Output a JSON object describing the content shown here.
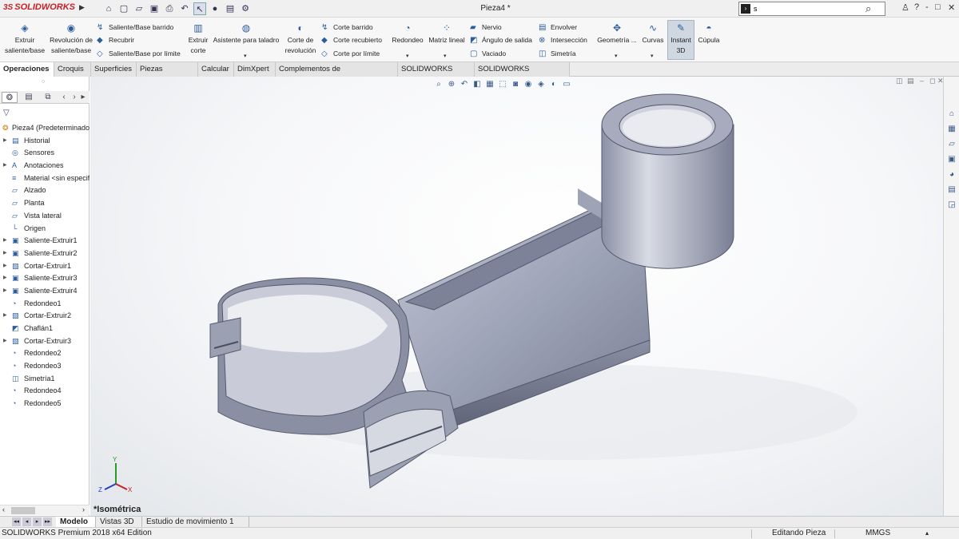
{
  "titlebar": {
    "logo_brand": "SOLIDWORKS",
    "logo_ds": "3S",
    "document_title": "Pieza4 *",
    "search_value": "s",
    "controls": [
      "?",
      "-",
      "—",
      "□",
      "✕"
    ]
  },
  "ribbon": {
    "extrude_boss": "Extruir saliente/base",
    "revolve_boss": "Revolución de saliente/base",
    "swept_boss": "Saliente/Base barrido",
    "loft_boss": "Recubrir",
    "boundary_boss": "Saliente/Base por límite",
    "extrude_cut": "Extruir corte",
    "hole_wizard": "Asistente para taladro",
    "revolve_cut": "Corte de revolución",
    "swept_cut": "Corte barrido",
    "loft_cut": "Corte recubierto",
    "boundary_cut": "Corte por límite",
    "fillet": "Redondeo",
    "linear_pattern": "Matriz lineal",
    "rib": "Nervio",
    "draft": "Ángulo de salida",
    "shell": "Vaciado",
    "wrap": "Envolver",
    "intersect": "Intersección",
    "mirror": "Simetría",
    "ref_geometry": "Geometría ...",
    "curves": "Curvas",
    "instant3d_line1": "Instant",
    "instant3d_line2": "3D",
    "dome": "Cúpula"
  },
  "command_tabs": [
    "Operaciones",
    "Croquis",
    "Superficies",
    "Piezas soldadas",
    "Calcular",
    "DimXpert",
    "Complementos de SOLIDWORKS",
    "SOLIDWORKS MBD",
    "SOLIDWORKS Inspection"
  ],
  "feature_tree": {
    "root": "Pieza4  (Predeterminado",
    "items": [
      {
        "label": "Historial",
        "icon": "history-icon",
        "glyph": "▤",
        "expand": true
      },
      {
        "label": "Sensores",
        "icon": "sensor-icon",
        "glyph": "◎",
        "expand": false
      },
      {
        "label": "Anotaciones",
        "icon": "annotation-icon",
        "glyph": "A",
        "expand": true
      },
      {
        "label": "Material <sin especificar>",
        "icon": "material-icon",
        "glyph": "≡",
        "expand": false
      },
      {
        "label": "Alzado",
        "icon": "plane-icon",
        "glyph": "▱",
        "expand": false
      },
      {
        "label": "Planta",
        "icon": "plane-icon",
        "glyph": "▱",
        "expand": false
      },
      {
        "label": "Vista lateral",
        "icon": "plane-icon",
        "glyph": "▱",
        "expand": false
      },
      {
        "label": "Origen",
        "icon": "origin-icon",
        "glyph": "└",
        "expand": false
      },
      {
        "label": "Saliente-Extruir1",
        "icon": "extrude-icon",
        "glyph": "▣",
        "expand": true
      },
      {
        "label": "Saliente-Extruir2",
        "icon": "extrude-icon",
        "glyph": "▣",
        "expand": true
      },
      {
        "label": "Cortar-Extruir1",
        "icon": "cut-icon",
        "glyph": "▧",
        "expand": true
      },
      {
        "label": "Saliente-Extruir3",
        "icon": "extrude-icon",
        "glyph": "▣",
        "expand": true
      },
      {
        "label": "Saliente-Extruir4",
        "icon": "extrude-icon",
        "glyph": "▣",
        "expand": true
      },
      {
        "label": "Redondeo1",
        "icon": "fillet-icon",
        "glyph": "◔",
        "expand": false
      },
      {
        "label": "Cortar-Extruir2",
        "icon": "cut-icon",
        "glyph": "▧",
        "expand": true
      },
      {
        "label": "Chaflán1",
        "icon": "chamfer-icon",
        "glyph": "◩",
        "expand": false
      },
      {
        "label": "Cortar-Extruir3",
        "icon": "cut-icon",
        "glyph": "▧",
        "expand": true
      },
      {
        "label": "Redondeo2",
        "icon": "fillet-icon",
        "glyph": "◔",
        "expand": false
      },
      {
        "label": "Redondeo3",
        "icon": "fillet-icon",
        "glyph": "◔",
        "expand": false
      },
      {
        "label": "Simetría1",
        "icon": "mirror-icon",
        "glyph": "◫",
        "expand": false
      },
      {
        "label": "Redondeo4",
        "icon": "fillet-icon",
        "glyph": "◔",
        "expand": false
      },
      {
        "label": "Redondeo5",
        "icon": "fillet-icon",
        "glyph": "◔",
        "expand": false
      }
    ]
  },
  "viewport": {
    "view_label": "*Isométrica",
    "model_fill": "#9fa5b8",
    "model_shade": "#6e7388"
  },
  "bottom_tabs": [
    "Modelo",
    "Vistas 3D",
    "Estudio de movimiento 1"
  ],
  "status_bar": {
    "product": "SOLIDWORKS Premium 2018 x64 Edition",
    "mode": "Editando Pieza",
    "units": "MMGS"
  }
}
